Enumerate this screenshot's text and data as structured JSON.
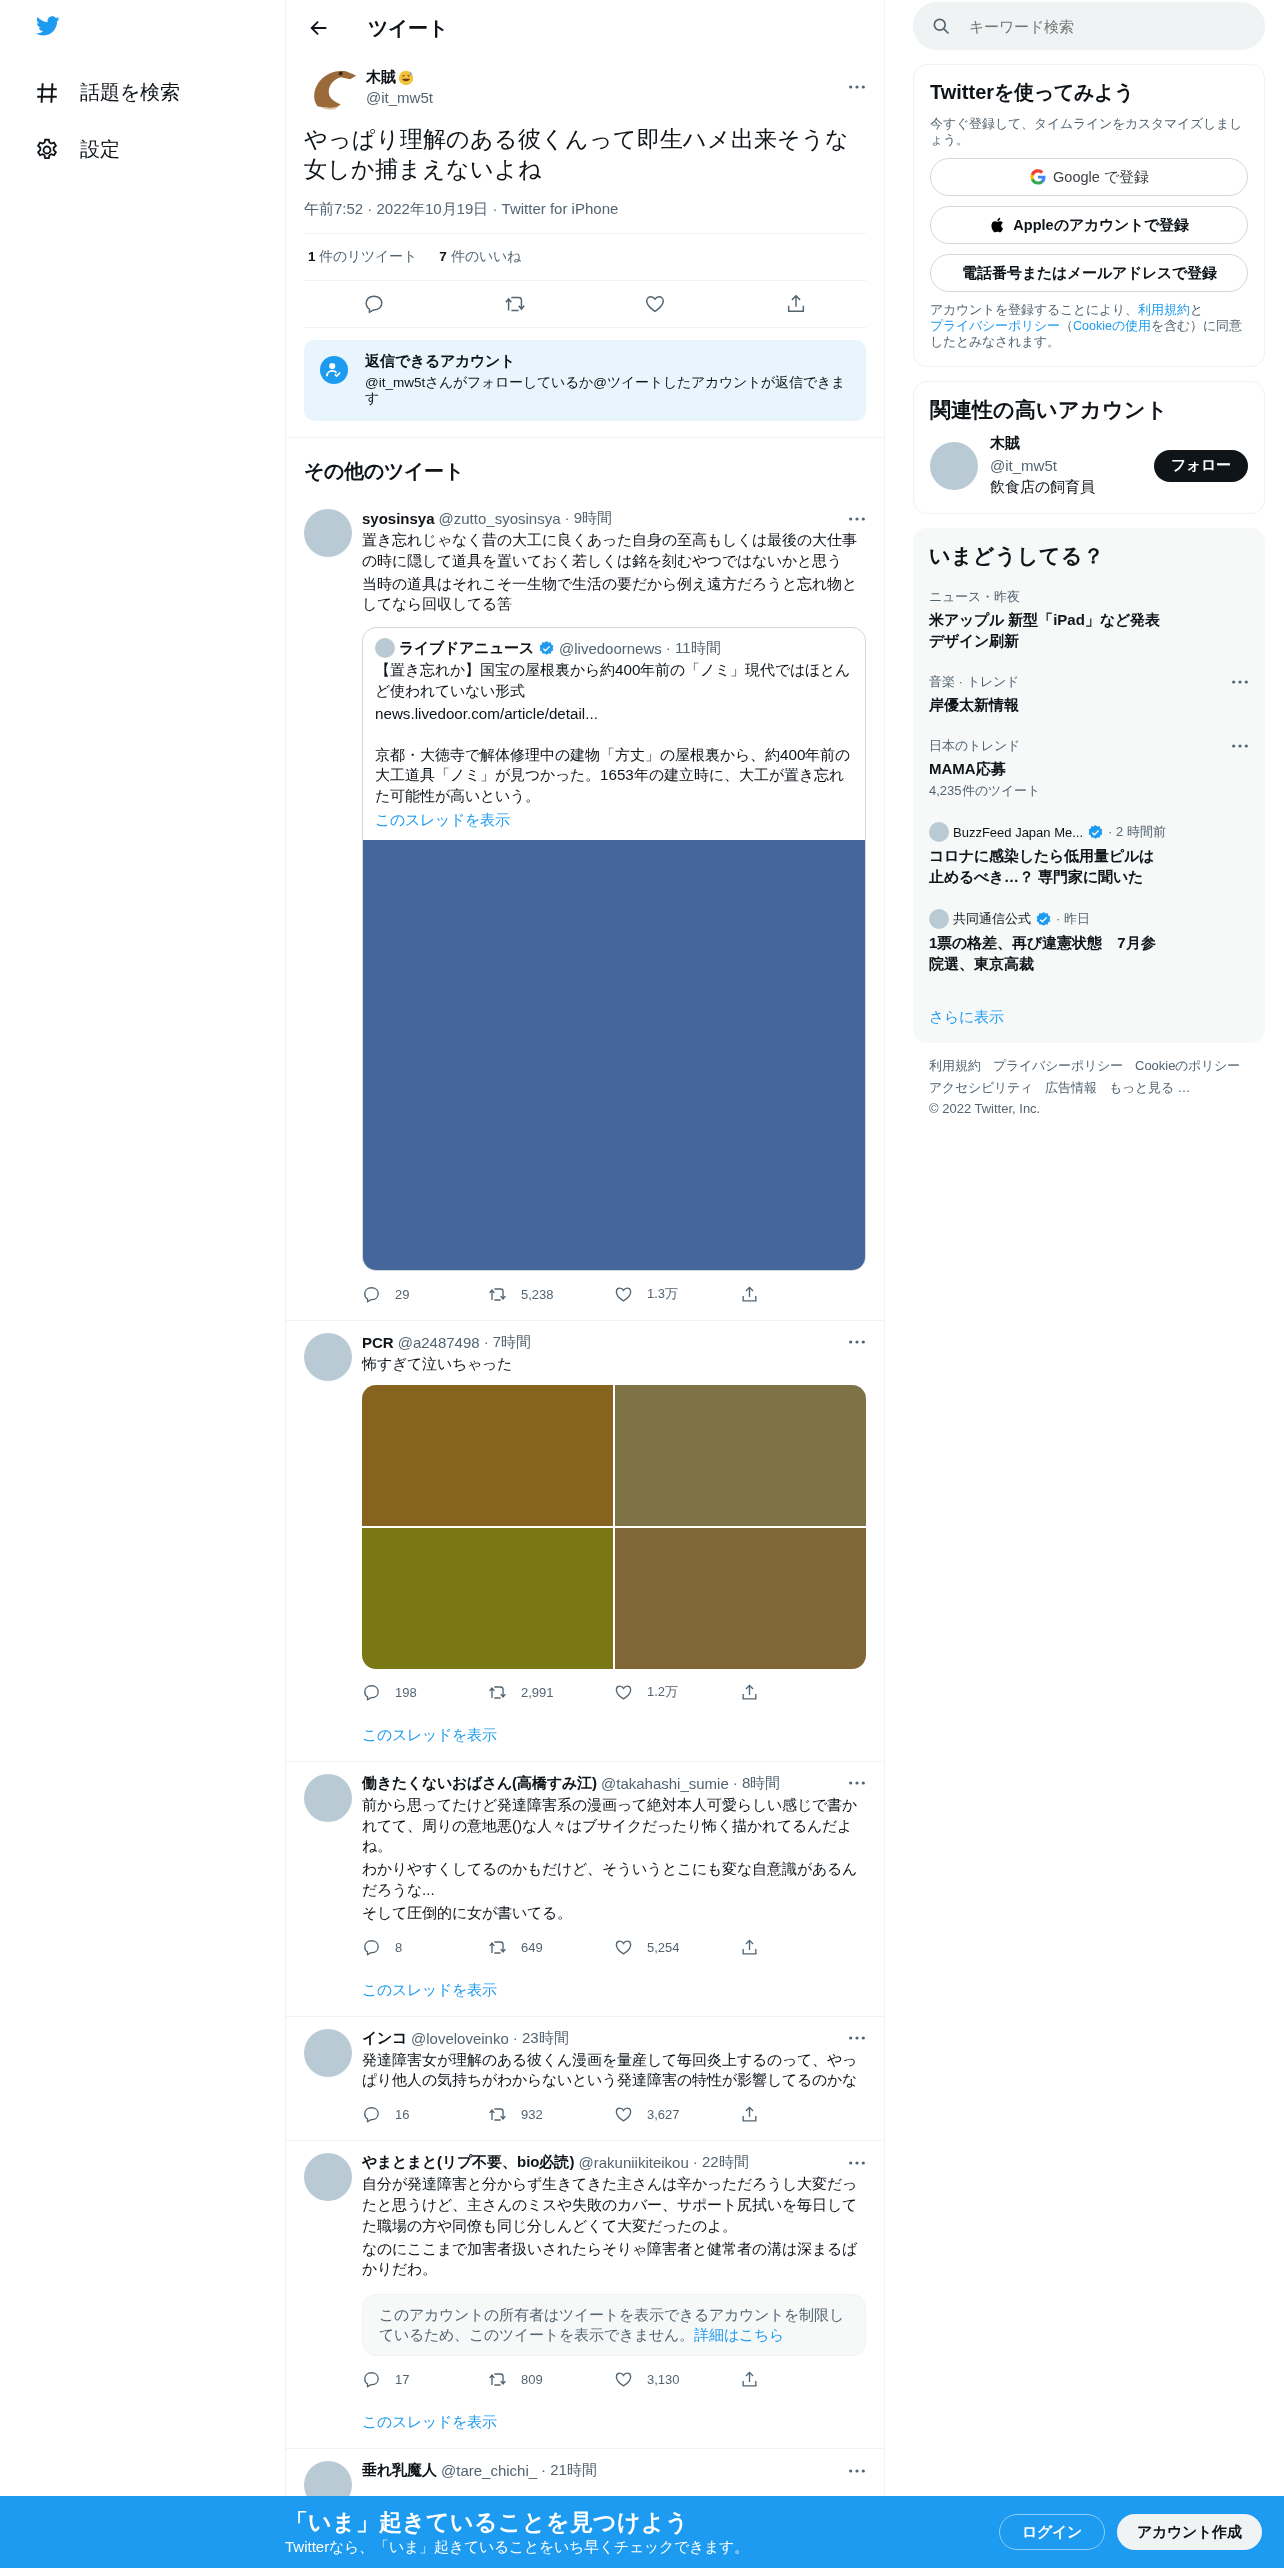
{
  "nav": {
    "items": [
      {
        "kind": "hashtag",
        "label": "話題を検索"
      },
      {
        "kind": "settings",
        "label": "設定"
      }
    ]
  },
  "header": {
    "title": "ツイート"
  },
  "main_tweet": {
    "name": "木賊",
    "handle": "@it_mw5t",
    "text": "やっぱり理解のある彼くんって即生ハメ出来そうな女しか捕まえないよね",
    "meta": "午前7:52 · 2022年10月19日 · Twitter for iPhone",
    "retweets_count": "1",
    "retweets_label": "件のリツイート",
    "likes_count": "7",
    "likes_label": "件のいいね"
  },
  "reply_notice": {
    "title": "返信できるアカウント",
    "text": "@it_mw5tさんがフォローしているか@ツイートしたアカウントが返信できます"
  },
  "more_heading": "その他のツイート",
  "tweets": [
    {
      "name": "syosinsya",
      "handle": "@zutto_syosinsya",
      "time": "· 9時間",
      "text": [
        "置き忘れじゃなく昔の大工に良くあった自身の至高もしくは最後の大仕事の時に隠して道具を置いておく若しくは銘を刻むやつではないかと思う",
        "当時の道具はそれこそ一生物で生活の要だから例え遠方だろうと忘れ物としてなら回収してる筈"
      ],
      "quote": {
        "name": "ライブドアニュース",
        "verified": true,
        "handle": "@livedoornews",
        "time": "· 11時間",
        "paragraphs": [
          [
            "【置き忘れか】国宝の屋根裏から約400年前の「ノミ」現代ではほとんど使われていない形式",
            "news.livedoor.com/article/detail..."
          ],
          [
            "京都・大徳寺で解体修理中の建物「方丈」の屋根裏から、約400年前の大工道具「ノミ」が見つかった。1653年の建立時に、大工が置き忘れた可能性が高いという。"
          ]
        ],
        "thread_link": "このスレッドを表示",
        "media": {
          "kind": "single",
          "tiles": [
            {
              "color": "#44669a"
            }
          ]
        }
      },
      "replies": "29",
      "retweets": "5,238",
      "likes": "1.3万"
    },
    {
      "name": "PCR",
      "handle": "@a2487498",
      "time": "· 7時間",
      "text": [
        "怖すぎて泣いちゃった"
      ],
      "media": {
        "kind": "grid",
        "tiles": [
          {
            "color": "#86641f"
          },
          {
            "color": "#7e7247"
          },
          {
            "color": "#7a7814"
          },
          {
            "color": "#816638"
          }
        ]
      },
      "replies": "198",
      "retweets": "2,991",
      "likes": "1.2万",
      "thread_link": "このスレッドを表示"
    },
    {
      "name": "働きたくないおばさん(高橋すみ江)",
      "handle": "@takahashi_sumie",
      "time": "· 8時間",
      "text": [
        "前から思ってたけど発達障害系の漫画って絶対本人可愛らしい感じで書かれてて、周りの意地悪()な人々はブサイクだったり怖く描かれてるんだよね。",
        "わかりやすくしてるのかもだけど、そういうとこにも変な自意識があるんだろうな...",
        "そして圧倒的に女が書いてる。"
      ],
      "replies": "8",
      "retweets": "649",
      "likes": "5,254",
      "thread_link": "このスレッドを表示"
    },
    {
      "name": "インコ",
      "handle": "@loveloveinko",
      "time": "· 23時間",
      "text": [
        "発達障害女が理解のある彼くん漫画を量産して毎回炎上するのって、やっぱり他人の気持ちがわからないという発達障害の特性が影響してるのかな"
      ],
      "replies": "16",
      "retweets": "932",
      "likes": "3,627"
    },
    {
      "name": "やまとまと(リプ不要、bio必読)",
      "handle": "@rakuniikiteikou",
      "time": "· 22時間",
      "text": [
        "自分が発達障害と分からず生きてきた主さんは辛かっただろうし大変だったと思うけど、主さんのミスや失敗のカバー、サポート尻拭いを毎日してた職場の方や同僚も同じ分しんどくて大変だったのよ。",
        "なのにここまで加害者扱いされたらそりゃ障害者と健常者の溝は深まるばかりだわ。"
      ],
      "notice": {
        "text": "このアカウントの所有者はツイートを表示できるアカウントを制限しているため、このツイートを表示できません。",
        "link": "詳細はこちら"
      },
      "replies": "17",
      "retweets": "809",
      "likes": "3,130",
      "thread_link": "このスレッドを表示"
    },
    {
      "name": "垂れ乳魔人",
      "handle": "@tare_chichi_",
      "time": "· 21時間"
    }
  ],
  "search": {
    "placeholder": "キーワード検索"
  },
  "signup": {
    "title": "Twitterを使ってみよう",
    "text": "今すぐ登録して、タイムラインをカスタマイズしましょう。",
    "buttons": [
      {
        "kind": "google",
        "label": "Google で登録"
      },
      {
        "kind": "apple",
        "label": "Appleのアカウントで登録"
      },
      {
        "kind": "plain",
        "label": "電話番号またはメールアドレスで登録"
      }
    ],
    "terms": [
      {
        "text": "アカウントを登録することにより、",
        "link": false
      },
      {
        "text": "利用規約",
        "link": true
      },
      {
        "text": "と",
        "link": false
      },
      {
        "text": "プライバシーポリシー",
        "link": true
      },
      {
        "text": "（",
        "link": false
      },
      {
        "text": "Cookieの使用",
        "link": true
      },
      {
        "text": "を含む）に同意したとみなされます。",
        "link": false
      }
    ]
  },
  "related": {
    "title": "関連性の高いアカウント",
    "name": "木賊",
    "handle": "@it_mw5t",
    "bio": "飲食店の飼育員",
    "button": "フォロー"
  },
  "trends": {
    "title": "いまどうしてる？",
    "items": [
      {
        "kind": "trend",
        "context": "ニュース・昨夜",
        "title": "米アップル 新型「iPad」など発表デザイン刷新",
        "more": false
      },
      {
        "kind": "trend",
        "context": "音楽 · トレンド",
        "title": "岸優太新情報",
        "more": true
      },
      {
        "kind": "trend",
        "context": "日本のトレンド",
        "title": "MAMA応募",
        "count": "4,235件のツイート",
        "more": true
      },
      {
        "kind": "news",
        "source": "BuzzFeed Japan Me...",
        "verified": true,
        "time": "· 2 時間前",
        "title": "コロナに感染したら低用量ピルは止めるべき…？ 専門家に聞いた"
      },
      {
        "kind": "news",
        "source": "共同通信公式",
        "verified": true,
        "time": "· 昨日",
        "title": "1票の格差、再び違憲状態　7月参院選、東京高裁"
      }
    ],
    "show_more": "さらに表示"
  },
  "footer": {
    "links": [
      "利用規約",
      "プライバシーポリシー",
      "Cookieのポリシー",
      "アクセシビリティ",
      "広告情報",
      "もっと見る …"
    ],
    "copyright": "© 2022 Twitter, Inc."
  },
  "banner": {
    "title": "「いま」起きていることを見つけよう",
    "subtitle": "Twitterなら、「いま」起きていることをいち早くチェックできます。",
    "login": "ログイン",
    "signup": "アカウント作成"
  }
}
